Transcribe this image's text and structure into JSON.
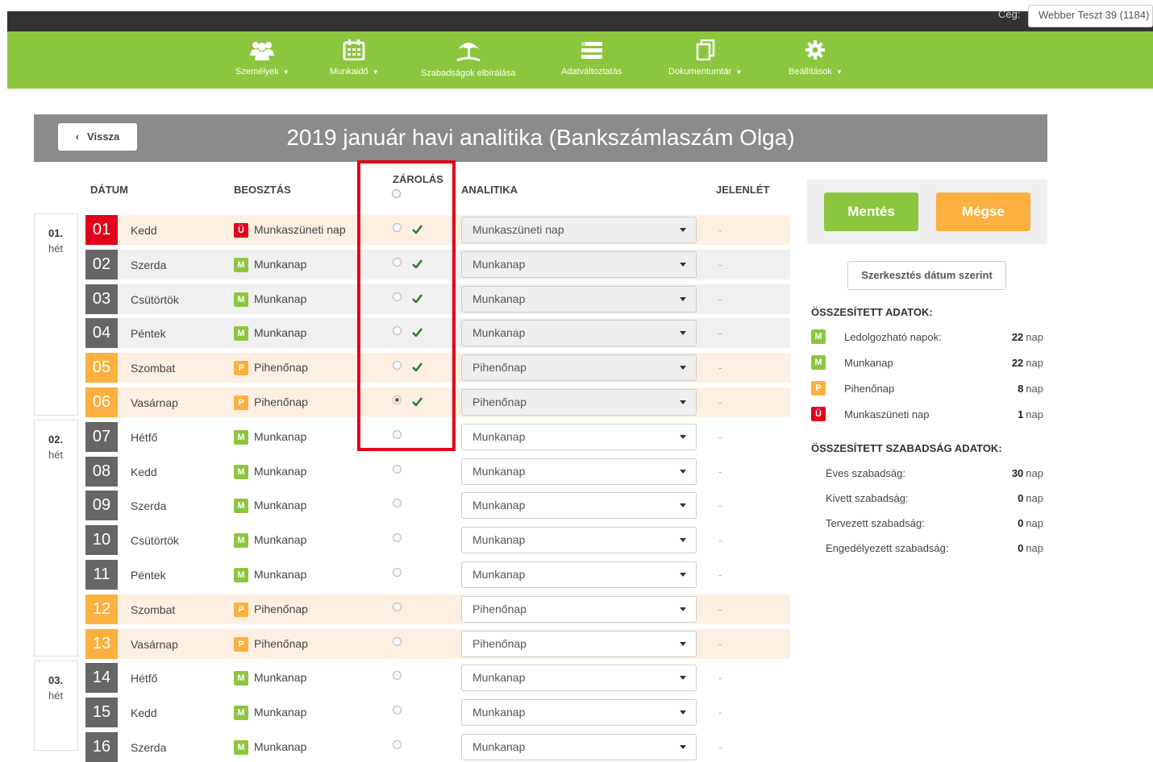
{
  "topbar": {
    "company_label": "Cég:",
    "company_value": "Webber Teszt 39 (1184)"
  },
  "nav": {
    "people": "Személyek",
    "worktime": "Munkaidő",
    "leave_review": "Szabadságok elbírálása",
    "data_change": "Adatváltoztatás",
    "documents": "Dokumentumtár",
    "settings": "Beállítások"
  },
  "header": {
    "back_label": "Vissza",
    "title": "2019 január havi analitika (Bankszámlaszám Olga)"
  },
  "columns": {
    "date": "DÁTUM",
    "schedule": "BEOSZTÁS",
    "lock": "ZÁROLÁS",
    "analytics": "ANALITIKA",
    "presence": "JELENLÉT"
  },
  "weeks": [
    {
      "num": "01.",
      "label": "hét"
    },
    {
      "num": "02.",
      "label": "hét"
    },
    {
      "num": "03.",
      "label": "hét"
    }
  ],
  "rows": [
    {
      "day": "01",
      "name": "Kedd",
      "badge": "Ü",
      "schedule": "Munkaszüneti nap",
      "analytics": "Munkaszüneti nap",
      "presence": "-"
    },
    {
      "day": "02",
      "name": "Szerda",
      "badge": "M",
      "schedule": "Munkanap",
      "analytics": "Munkanap",
      "presence": "-"
    },
    {
      "day": "03",
      "name": "Csütörtök",
      "badge": "M",
      "schedule": "Munkanap",
      "analytics": "Munkanap",
      "presence": "-"
    },
    {
      "day": "04",
      "name": "Péntek",
      "badge": "M",
      "schedule": "Munkanap",
      "analytics": "Munkanap",
      "presence": "-"
    },
    {
      "day": "05",
      "name": "Szombat",
      "badge": "P",
      "schedule": "Pihenőnap",
      "analytics": "Pihenőnap",
      "presence": "-"
    },
    {
      "day": "06",
      "name": "Vasárnap",
      "badge": "P",
      "schedule": "Pihenőnap",
      "analytics": "Pihenőnap",
      "presence": "-"
    },
    {
      "day": "07",
      "name": "Hétfő",
      "badge": "M",
      "schedule": "Munkanap",
      "analytics": "Munkanap",
      "presence": "-"
    },
    {
      "day": "08",
      "name": "Kedd",
      "badge": "M",
      "schedule": "Munkanap",
      "analytics": "Munkanap",
      "presence": "-"
    },
    {
      "day": "09",
      "name": "Szerda",
      "badge": "M",
      "schedule": "Munkanap",
      "analytics": "Munkanap",
      "presence": "-"
    },
    {
      "day": "10",
      "name": "Csütörtök",
      "badge": "M",
      "schedule": "Munkanap",
      "analytics": "Munkanap",
      "presence": "-"
    },
    {
      "day": "11",
      "name": "Péntek",
      "badge": "M",
      "schedule": "Munkanap",
      "analytics": "Munkanap",
      "presence": "-"
    },
    {
      "day": "12",
      "name": "Szombat",
      "badge": "P",
      "schedule": "Pihenőnap",
      "analytics": "Pihenőnap",
      "presence": "-"
    },
    {
      "day": "13",
      "name": "Vasárnap",
      "badge": "P",
      "schedule": "Pihenőnap",
      "analytics": "Pihenőnap",
      "presence": "-"
    },
    {
      "day": "14",
      "name": "Hétfő",
      "badge": "M",
      "schedule": "Munkanap",
      "analytics": "Munkanap",
      "presence": "-"
    },
    {
      "day": "15",
      "name": "Kedd",
      "badge": "M",
      "schedule": "Munkanap",
      "analytics": "Munkanap",
      "presence": "-"
    },
    {
      "day": "16",
      "name": "Szerda",
      "badge": "M",
      "schedule": "Munkanap",
      "analytics": "Munkanap",
      "presence": "-"
    }
  ],
  "actions": {
    "save": "Mentés",
    "cancel": "Mégse",
    "edit_by_date": "Szerkesztés dátum szerint"
  },
  "summary": {
    "heading": "ÖSSZESÍTETT ADATOK:",
    "unit": "nap",
    "items": [
      {
        "badge": "M",
        "label": "Ledolgozható napok:",
        "value": "22"
      },
      {
        "badge": "M",
        "label": "Munkanap",
        "value": "22"
      },
      {
        "badge": "P",
        "label": "Pihenőnap",
        "value": "8"
      },
      {
        "badge": "Ü",
        "label": "Munkaszüneti nap",
        "value": "1"
      }
    ]
  },
  "leave_summary": {
    "heading": "ÖSSZESÍTETT SZABADSÁG ADATOK:",
    "unit": "nap",
    "items": [
      {
        "label": "Éves szabadság:",
        "value": "30"
      },
      {
        "label": "Kivett szabadság:",
        "value": "0"
      },
      {
        "label": "Tervezett szabadság:",
        "value": "0"
      },
      {
        "label": "Engedélyezett szabadság:",
        "value": "0"
      }
    ]
  },
  "colors": {
    "green": "#8cc63f",
    "orange": "#fbb040",
    "red": "#e2001a",
    "gray_day": "#666666",
    "highlight": "#e2001a"
  }
}
